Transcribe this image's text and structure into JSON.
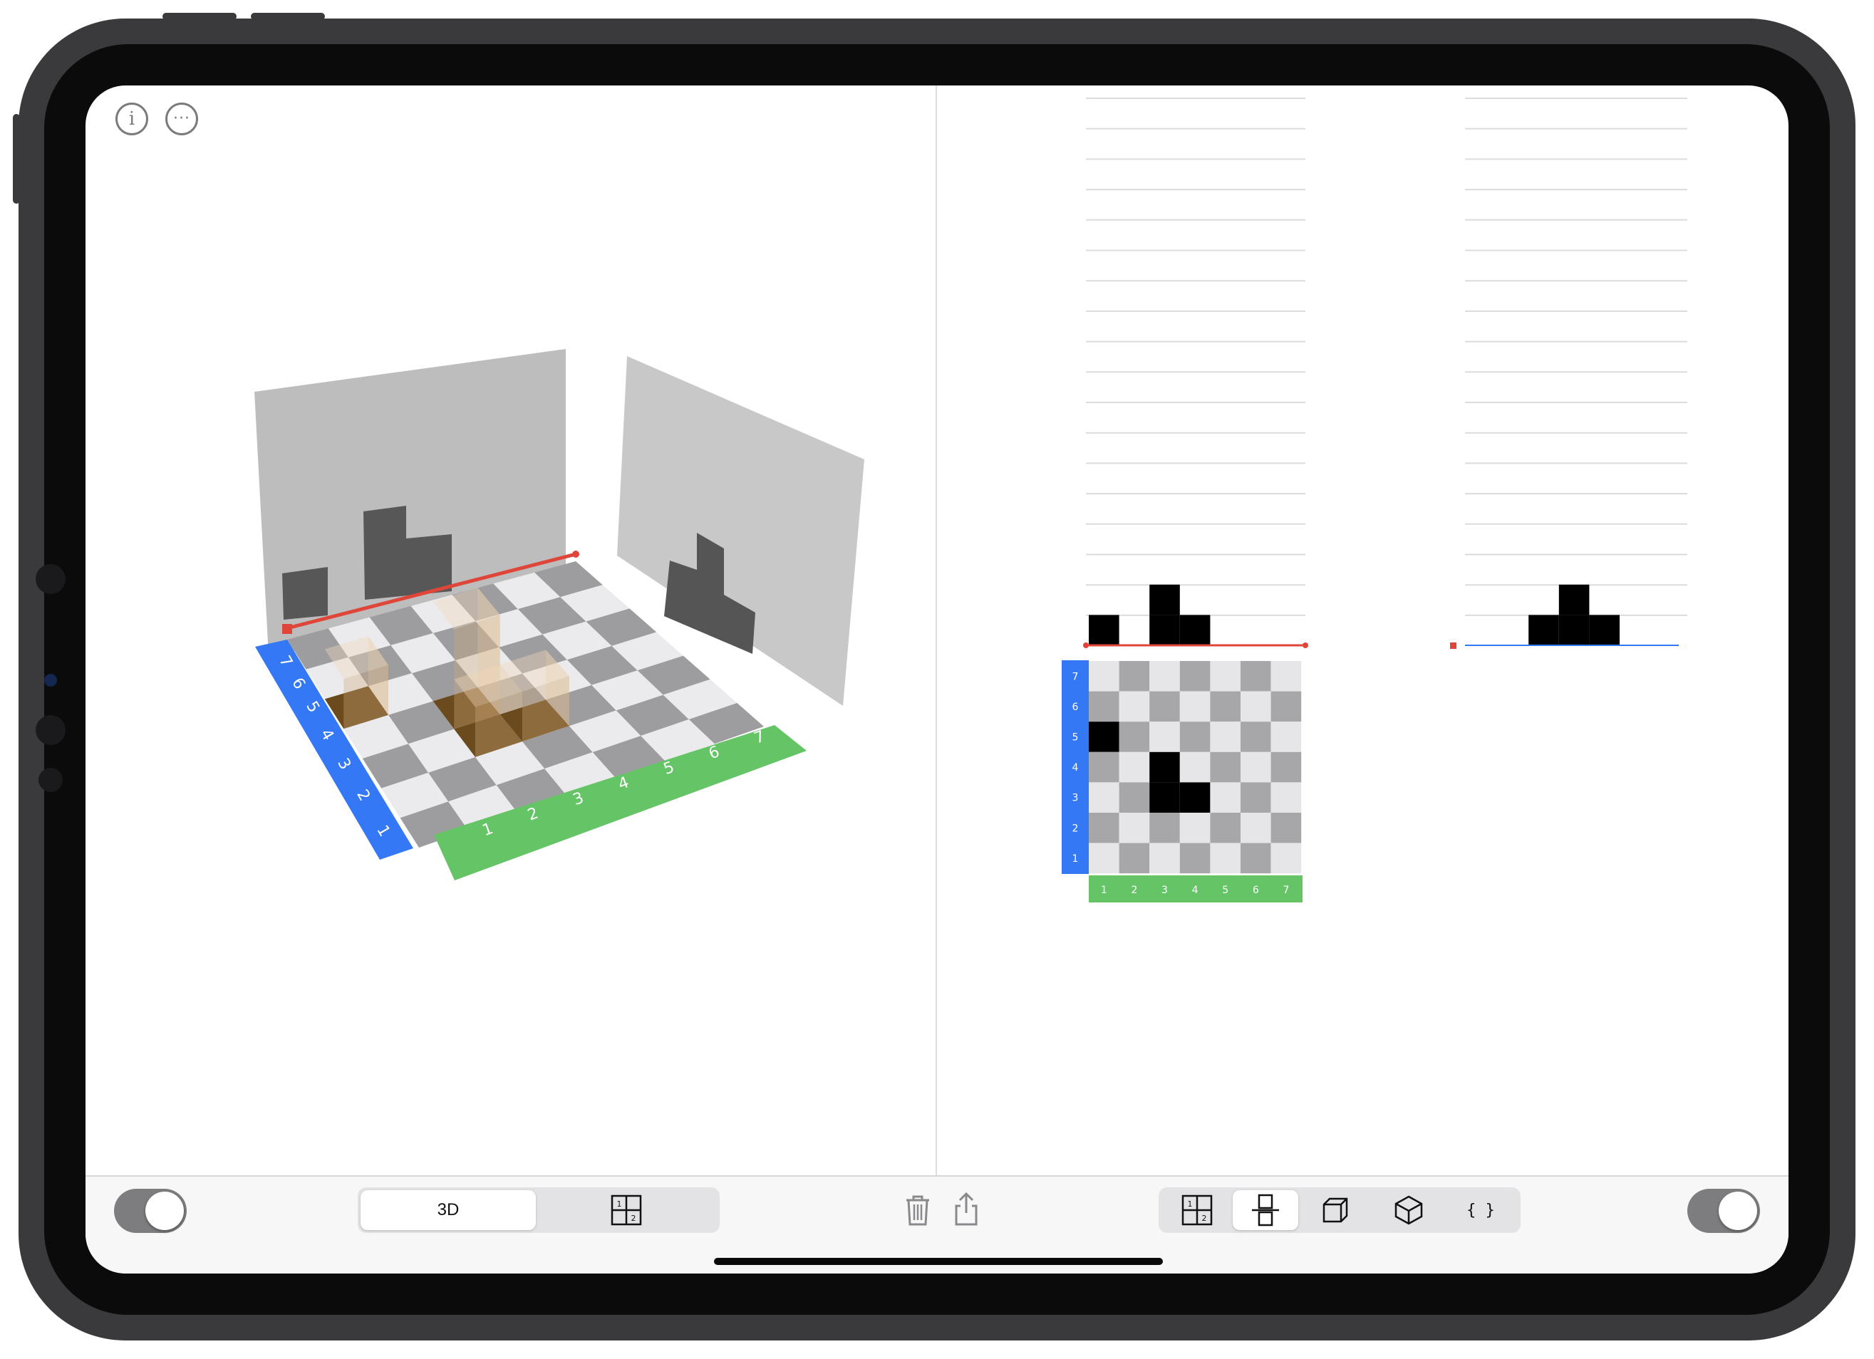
{
  "toolbar": {
    "view_mode_options": [
      {
        "label": "3D",
        "selected": true
      },
      {
        "icon": "split-grid-icon",
        "selected": false
      }
    ],
    "center_actions": [
      {
        "icon": "trash-icon"
      },
      {
        "icon": "share-icon"
      }
    ],
    "view_options": [
      {
        "icon": "grid-numbered-icon",
        "selected": false
      },
      {
        "icon": "stacked-squares-icon",
        "selected": true
      },
      {
        "icon": "cube-icon",
        "selected": false
      },
      {
        "icon": "isometric-cube-icon",
        "selected": false
      },
      {
        "label": "{ }",
        "selected": false
      }
    ],
    "left_toggle": {
      "on": false
    },
    "right_toggle": {
      "on": false
    }
  },
  "top_icons": [
    {
      "icon": "info-icon",
      "glyph": "i"
    },
    {
      "icon": "more-icon",
      "glyph": "···"
    }
  ],
  "board": {
    "size": 7,
    "x_axis_labels": [
      "1",
      "2",
      "3",
      "4",
      "5",
      "6",
      "7"
    ],
    "y_axis_labels": [
      "7",
      "6",
      "5",
      "4",
      "3",
      "2",
      "1"
    ],
    "occupied_cells": [
      [
        1,
        5
      ],
      [
        3,
        4
      ],
      [
        3,
        3
      ],
      [
        4,
        3
      ]
    ],
    "colors": {
      "x_axis": "#64c466",
      "y_axis": "#3478f6",
      "filled": "#000000",
      "light_cell": "#e6e6e8",
      "dark_cell": "#a7a7a9",
      "red_line": "#e0453a",
      "blue_line": "#3478f6"
    }
  },
  "front_projection_heights": [
    1,
    0,
    2,
    1,
    0,
    0,
    0
  ],
  "side_projection_heights": [
    0,
    0,
    1,
    2,
    1,
    0,
    0
  ]
}
